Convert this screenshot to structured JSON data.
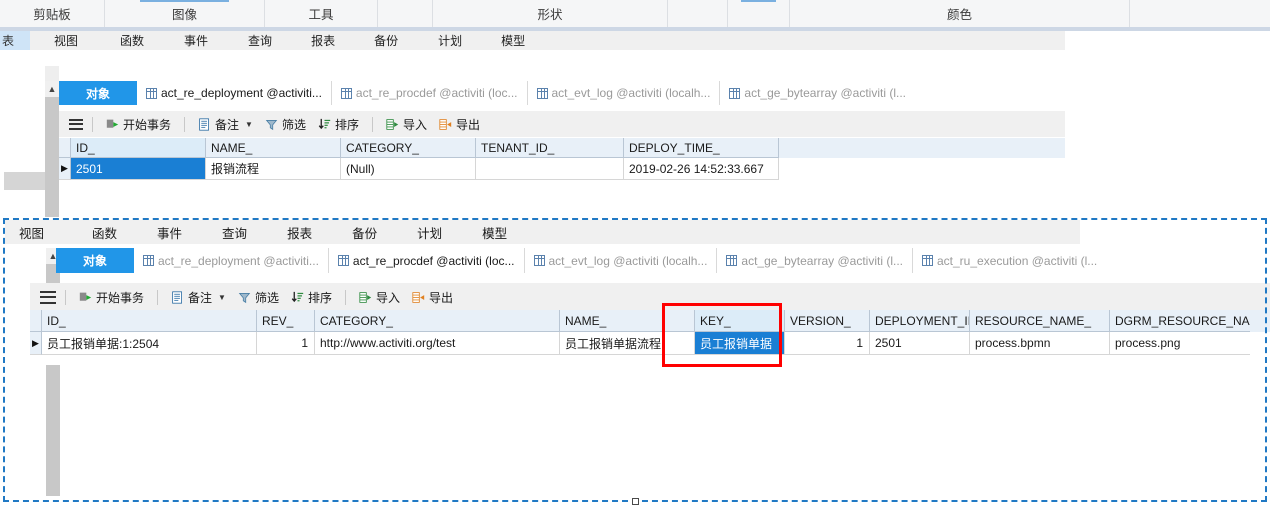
{
  "ribbon": {
    "groups": [
      {
        "label": "剪贴板",
        "selected": false
      },
      {
        "label": "图像",
        "selected": true
      },
      {
        "label": "工具",
        "selected": false
      },
      {
        "label": "",
        "selected": false
      },
      {
        "label": "形状",
        "selected": false
      },
      {
        "label": "",
        "selected": false
      },
      {
        "label": "",
        "selected": true
      },
      {
        "label": "颜色",
        "selected": false
      }
    ]
  },
  "top_panel": {
    "menubar": {
      "partial_item": "表",
      "items": [
        "视图",
        "函数",
        "事件",
        "查询",
        "报表",
        "备份",
        "计划",
        "模型"
      ]
    },
    "tabs": [
      {
        "label": "对象",
        "type": "object",
        "active": true
      },
      {
        "label": "act_re_deployment @activiti...",
        "type": "table",
        "active": true
      },
      {
        "label": "act_re_procdef @activiti (loc...",
        "type": "table",
        "active": false
      },
      {
        "label": "act_evt_log @activiti (localh...",
        "type": "table",
        "active": false
      },
      {
        "label": "act_ge_bytearray @activiti (l...",
        "type": "table",
        "active": false
      }
    ],
    "toolbar": [
      {
        "label": "开始事务",
        "icon": "start-transaction-icon"
      },
      {
        "label": "备注",
        "icon": "note-icon",
        "has_caret": true
      },
      {
        "label": "筛选",
        "icon": "filter-icon"
      },
      {
        "label": "排序",
        "icon": "sort-icon"
      },
      {
        "label": "导入",
        "icon": "import-icon"
      },
      {
        "label": "导出",
        "icon": "export-icon"
      }
    ],
    "grid": {
      "columns": [
        "ID_",
        "NAME_",
        "CATEGORY_",
        "TENANT_ID_",
        "DEPLOY_TIME_"
      ],
      "widths": [
        135,
        135,
        135,
        148,
        155
      ],
      "rows": [
        {
          "cells": [
            "2501",
            "报销流程",
            "(Null)",
            "",
            "2019-02-26 14:52:33.667"
          ],
          "selected_index": 0,
          "null_index": 2
        }
      ]
    }
  },
  "bottom_panel": {
    "menubar": [
      "视图",
      "函数",
      "事件",
      "查询",
      "报表",
      "备份",
      "计划",
      "模型"
    ],
    "tabs": [
      {
        "label": "对象",
        "type": "object",
        "active": true
      },
      {
        "label": "act_re_deployment @activiti...",
        "type": "table",
        "active": false
      },
      {
        "label": "act_re_procdef @activiti (loc...",
        "type": "table",
        "active": true
      },
      {
        "label": "act_evt_log @activiti (localh...",
        "type": "table",
        "active": false
      },
      {
        "label": "act_ge_bytearray @activiti (l...",
        "type": "table",
        "active": false
      },
      {
        "label": "act_ru_execution @activiti (l...",
        "type": "table",
        "active": false
      }
    ],
    "toolbar": [
      {
        "label": "开始事务",
        "icon": "start-transaction-icon"
      },
      {
        "label": "备注",
        "icon": "note-icon",
        "has_caret": true
      },
      {
        "label": "筛选",
        "icon": "filter-icon"
      },
      {
        "label": "排序",
        "icon": "sort-icon"
      },
      {
        "label": "导入",
        "icon": "import-icon"
      },
      {
        "label": "导出",
        "icon": "export-icon"
      }
    ],
    "grid": {
      "columns": [
        "ID_",
        "REV_",
        "CATEGORY_",
        "NAME_",
        "KEY_",
        "VERSION_",
        "DEPLOYMENT_ID_",
        "RESOURCE_NAME_",
        "DGRM_RESOURCE_NAM"
      ],
      "widths": [
        215,
        58,
        245,
        135,
        90,
        85,
        100,
        140,
        140
      ],
      "rows": [
        {
          "cells": [
            "员工报销单据:1:2504",
            "1",
            "http://www.activiti.org/test",
            "员工报销单据流程",
            "员工报销单据",
            "1",
            "2501",
            "process.bpmn",
            "process.png"
          ],
          "selected_index": 4,
          "numeric_indexes": [
            1,
            5
          ]
        }
      ]
    },
    "annotation": {
      "type": "red-rectangle",
      "color": "#ff0000",
      "target_column": "KEY_",
      "target_value": "员工报销单据"
    }
  },
  "colors": {
    "accent_blue": "#2196e8",
    "selection_blue": "#1a7fd4",
    "annotation_red": "#ff0000",
    "header_blue": "#e8f0f8",
    "dashed_selection": "#2079c4"
  }
}
